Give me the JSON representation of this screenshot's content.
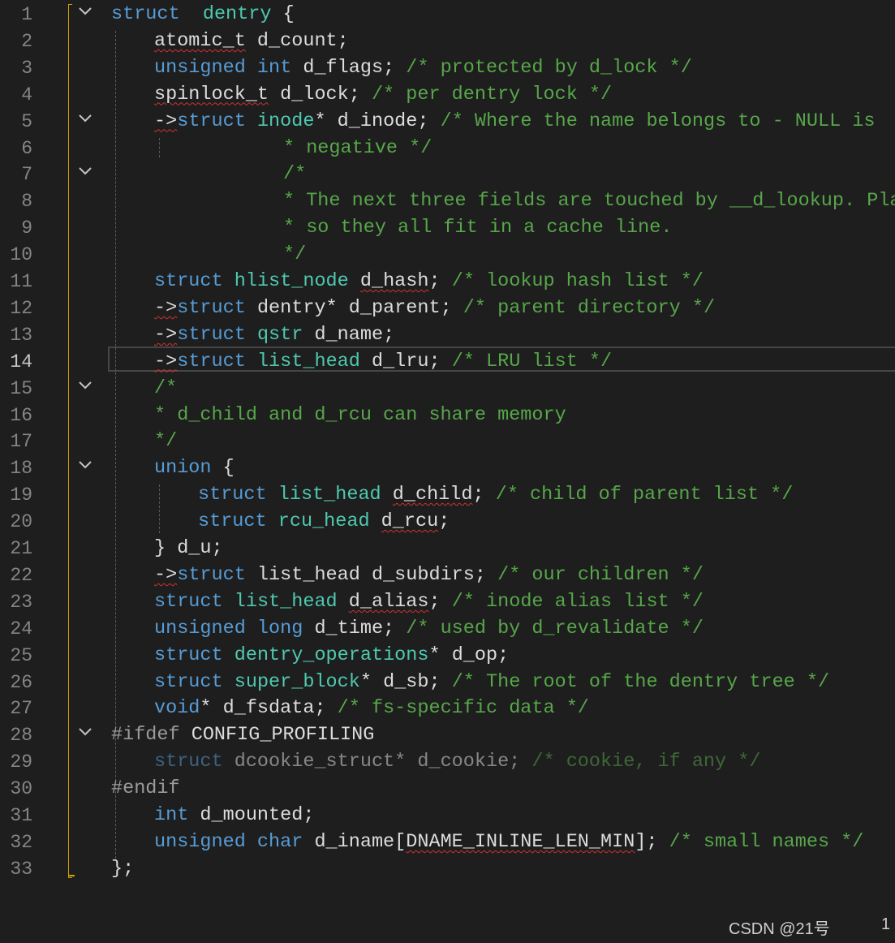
{
  "editor": {
    "active_line": 14,
    "lines": [
      {
        "n": "1",
        "fold": true,
        "tokens": [
          [
            "kw",
            "struct"
          ],
          [
            "",
            "  "
          ],
          [
            "ty",
            "dentry"
          ],
          [
            "",
            " {"
          ]
        ]
      },
      {
        "n": "2",
        "tokens": [
          [
            "sq",
            "atomic_t"
          ],
          [
            "",
            " d_count;"
          ]
        ]
      },
      {
        "n": "3",
        "tokens": [
          [
            "kw",
            "unsigned int"
          ],
          [
            "",
            " d_flags; "
          ],
          [
            "cm",
            "/* protected by d_lock */"
          ]
        ]
      },
      {
        "n": "4",
        "tokens": [
          [
            "sq",
            "spinlock_t"
          ],
          [
            "",
            " d_lock; "
          ],
          [
            "cm",
            "/* per dentry lock */"
          ]
        ]
      },
      {
        "n": "5",
        "fold": true,
        "tokens": [
          [
            "sq",
            "->"
          ],
          [
            "kw",
            "struct"
          ],
          [
            "",
            " "
          ],
          [
            "ty",
            "inode"
          ],
          [
            "",
            "* d_inode; "
          ],
          [
            "cm",
            "/* Where the name belongs to - NULL is"
          ]
        ]
      },
      {
        "n": "6",
        "tokens": [
          [
            "cm",
            "* negative */"
          ]
        ]
      },
      {
        "n": "7",
        "fold": true,
        "tokens": [
          [
            "cm",
            "/*"
          ]
        ]
      },
      {
        "n": "8",
        "tokens": [
          [
            "cm",
            "* The next three fields are touched by __d_lookup. Place"
          ]
        ]
      },
      {
        "n": "9",
        "tokens": [
          [
            "cm",
            "* so they all fit in a cache line."
          ]
        ]
      },
      {
        "n": "10",
        "tokens": [
          [
            "cm",
            "*/"
          ]
        ]
      },
      {
        "n": "11",
        "tokens": [
          [
            "kw",
            "struct"
          ],
          [
            "",
            " "
          ],
          [
            "ty",
            "hlist_node"
          ],
          [
            "",
            " "
          ],
          [
            "sq",
            "d_hash"
          ],
          [
            "",
            ";"
          ],
          [
            "",
            " "
          ],
          [
            "cm",
            "/* lookup hash list */"
          ]
        ]
      },
      {
        "n": "12",
        "tokens": [
          [
            "sq",
            "->"
          ],
          [
            "kw",
            "struct"
          ],
          [
            "",
            " dentry* d_parent; "
          ],
          [
            "cm",
            "/* parent directory */"
          ]
        ]
      },
      {
        "n": "13",
        "tokens": [
          [
            "sq",
            "->"
          ],
          [
            "kw",
            "struct"
          ],
          [
            "",
            " "
          ],
          [
            "ty",
            "qstr"
          ],
          [
            "",
            " d_name;"
          ]
        ]
      },
      {
        "n": "14",
        "tokens": [
          [
            "sq",
            "->"
          ],
          [
            "kw",
            "struct"
          ],
          [
            "",
            " "
          ],
          [
            "ty",
            "list_head"
          ],
          [
            "",
            " d_lru; "
          ],
          [
            "cm",
            "/* LRU list */"
          ]
        ]
      },
      {
        "n": "15",
        "fold": true,
        "tokens": [
          [
            "cm",
            "/*"
          ]
        ]
      },
      {
        "n": "16",
        "tokens": [
          [
            "cm",
            "* d_child and d_rcu can share memory"
          ]
        ]
      },
      {
        "n": "17",
        "tokens": [
          [
            "cm",
            "*/"
          ]
        ]
      },
      {
        "n": "18",
        "fold": true,
        "tokens": [
          [
            "kw",
            "union"
          ],
          [
            "",
            " {"
          ]
        ]
      },
      {
        "n": "19",
        "tokens": [
          [
            "kw",
            "struct"
          ],
          [
            "",
            " "
          ],
          [
            "ty",
            "list_head"
          ],
          [
            "",
            " "
          ],
          [
            "sq",
            "d_child"
          ],
          [
            "",
            "; "
          ],
          [
            "cm",
            "/* child of parent list */"
          ]
        ]
      },
      {
        "n": "20",
        "tokens": [
          [
            "kw",
            "struct"
          ],
          [
            "",
            " "
          ],
          [
            "ty",
            "rcu_head"
          ],
          [
            "",
            " "
          ],
          [
            "sq",
            "d_rcu"
          ],
          [
            "",
            ";"
          ]
        ]
      },
      {
        "n": "21",
        "tokens": [
          [
            "",
            "} d_u;"
          ]
        ]
      },
      {
        "n": "22",
        "tokens": [
          [
            "sq",
            "->"
          ],
          [
            "kw",
            "struct"
          ],
          [
            "",
            " list_head d_subdirs; "
          ],
          [
            "cm",
            "/* our children */"
          ]
        ]
      },
      {
        "n": "23",
        "tokens": [
          [
            "kw",
            "struct"
          ],
          [
            "",
            " "
          ],
          [
            "ty",
            "list_head"
          ],
          [
            "",
            " "
          ],
          [
            "sq",
            "d_alias"
          ],
          [
            "",
            "; "
          ],
          [
            "cm",
            "/* inode alias list */"
          ]
        ]
      },
      {
        "n": "24",
        "tokens": [
          [
            "kw",
            "unsigned long"
          ],
          [
            "",
            " d_time; "
          ],
          [
            "cm",
            "/* used by d_revalidate */"
          ]
        ]
      },
      {
        "n": "25",
        "tokens": [
          [
            "kw",
            "struct"
          ],
          [
            "",
            " "
          ],
          [
            "ty",
            "dentry_operations"
          ],
          [
            "",
            "* d_op;"
          ]
        ]
      },
      {
        "n": "26",
        "tokens": [
          [
            "kw",
            "struct"
          ],
          [
            "",
            " "
          ],
          [
            "ty",
            "super_block"
          ],
          [
            "",
            "* d_sb; "
          ],
          [
            "cm",
            "/* The root of the dentry tree */"
          ]
        ]
      },
      {
        "n": "27",
        "tokens": [
          [
            "kw",
            "void"
          ],
          [
            "",
            "* d_fsdata; "
          ],
          [
            "cm",
            "/* fs-specific data */"
          ]
        ]
      },
      {
        "n": "28",
        "fold": true,
        "tokens": [
          [
            "pp",
            "#ifdef"
          ],
          [
            "",
            " CONFIG_PROFILING"
          ]
        ]
      },
      {
        "n": "29",
        "tokens": [
          [
            "dimkw",
            "struct"
          ],
          [
            "dim",
            " dcookie_struct* d_cookie; "
          ],
          [
            "dimcm",
            "/* cookie, if any */"
          ]
        ]
      },
      {
        "n": "30",
        "tokens": [
          [
            "pp",
            "#endif"
          ]
        ]
      },
      {
        "n": "31",
        "tokens": [
          [
            "kw",
            "int"
          ],
          [
            "",
            " d_mounted;"
          ]
        ]
      },
      {
        "n": "32",
        "tokens": [
          [
            "kw",
            "unsigned char"
          ],
          [
            "",
            " d_iname["
          ],
          [
            "sq",
            "DNAME_INLINE_LEN_MIN"
          ],
          [
            "",
            "]; "
          ],
          [
            "cm",
            "/* small names */"
          ]
        ]
      },
      {
        "n": "33",
        "tokens": [
          [
            "",
            "};"
          ]
        ]
      }
    ]
  },
  "footer": {
    "watermark": "CSDN @21号",
    "right_number": "1"
  }
}
